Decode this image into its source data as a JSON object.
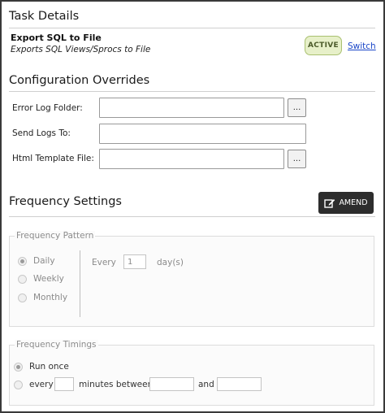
{
  "task_details": {
    "title": "Task Details",
    "name": "Export SQL to File",
    "description": "Exports SQL Views/Sprocs to File",
    "status_badge": "ACTIVE",
    "switch_link": "Switch"
  },
  "configuration": {
    "title": "Configuration Overrides",
    "fields": [
      {
        "label": "Error Log Folder:",
        "value": "",
        "has_browse": true
      },
      {
        "label": "Send Logs To:",
        "value": "",
        "has_browse": false
      },
      {
        "label": "Html Template File:",
        "value": "",
        "has_browse": true
      }
    ],
    "browse_label": "..."
  },
  "frequency": {
    "title": "Frequency Settings",
    "amend_label": "AMEND",
    "amend_icon": "edit-icon",
    "pattern": {
      "legend": "Frequency Pattern",
      "options": [
        "Daily",
        "Weekly",
        "Monthly"
      ],
      "selected": "Daily",
      "every_label": "Every",
      "every_value": "1",
      "unit_label": "day(s)"
    },
    "timings": {
      "legend": "Frequency Timings",
      "run_once_label": "Run once",
      "every_label": "every",
      "minutes_between_label": "minutes between",
      "and_label": "and",
      "selected": "Run once"
    }
  }
}
